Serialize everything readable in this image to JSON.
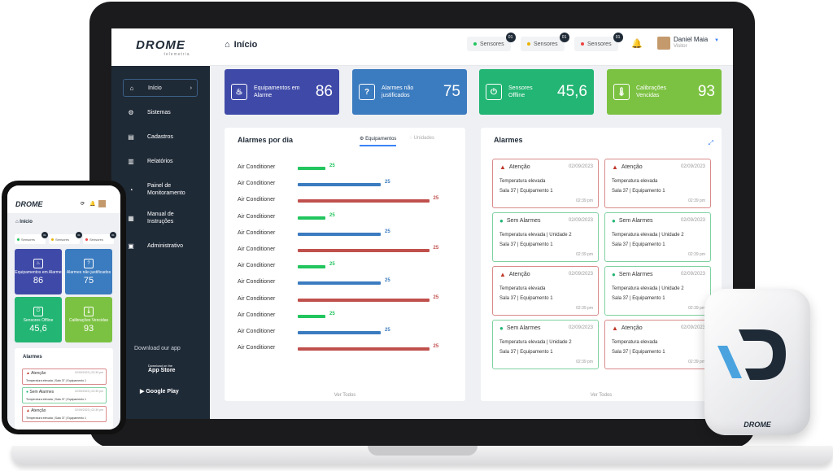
{
  "header": {
    "logo": "DROME",
    "logo_sub": "telemetria",
    "title": "Início",
    "chips": [
      {
        "label": "Sensores",
        "badge": "01",
        "color": "#22c55e"
      },
      {
        "label": "Sensores",
        "badge": "01",
        "color": "#eab308"
      },
      {
        "label": "Sensores",
        "badge": "01",
        "color": "#ef4444"
      }
    ],
    "user_name": "Daniel Maia",
    "user_role": "Visitor"
  },
  "sidebar": {
    "items": [
      {
        "label": "Início",
        "icon": "home-icon"
      },
      {
        "label": "Sistemas",
        "icon": "systems-icon"
      },
      {
        "label": "Cadastros",
        "icon": "register-icon"
      },
      {
        "label": "Relatórios",
        "icon": "reports-icon"
      },
      {
        "label": "Painel de Monitoramento",
        "icon": "pie-icon"
      },
      {
        "label": "Manual de Instruções",
        "icon": "manual-icon"
      },
      {
        "label": "Administrativo",
        "icon": "admin-icon"
      }
    ],
    "download": "Download our app",
    "app_store": "App Store",
    "app_store_small": "Download on the",
    "google_play": "Google Play"
  },
  "stats": [
    {
      "label": "Equipamentos em Alarme",
      "value": "86",
      "color": "#3f4aa8",
      "icon": "alarm-icon"
    },
    {
      "label": "Alarmes não justificados",
      "value": "75",
      "color": "#3b7bbf",
      "icon": "question-icon"
    },
    {
      "label": "Sensores Offline",
      "value": "45,6",
      "color": "#22b573",
      "icon": "power-icon"
    },
    {
      "label": "Calibrações Vencidas",
      "value": "93",
      "color": "#7cc242",
      "icon": "thermometer-icon"
    }
  ],
  "daily": {
    "title": "Alarmes por dia",
    "tab_active": "Equipamentos",
    "tab_inactive": "Unidades",
    "footer": "Ver Todos",
    "rows": [
      {
        "label": "Air Conditioner",
        "value": "25",
        "fraction": 0.2,
        "color": "#22c55e"
      },
      {
        "label": "Air Conditioner",
        "value": "25",
        "fraction": 0.6,
        "color": "#3b7bbf"
      },
      {
        "label": "Air Conditioner",
        "value": "25",
        "fraction": 0.95,
        "color": "#c0504d"
      },
      {
        "label": "Air Conditioner",
        "value": "25",
        "fraction": 0.2,
        "color": "#22c55e"
      },
      {
        "label": "Air Conditioner",
        "value": "25",
        "fraction": 0.6,
        "color": "#3b7bbf"
      },
      {
        "label": "Air Conditioner",
        "value": "25",
        "fraction": 0.95,
        "color": "#c0504d"
      },
      {
        "label": "Air Conditioner",
        "value": "25",
        "fraction": 0.2,
        "color": "#22c55e"
      },
      {
        "label": "Air Conditioner",
        "value": "25",
        "fraction": 0.6,
        "color": "#3b7bbf"
      },
      {
        "label": "Air Conditioner",
        "value": "25",
        "fraction": 0.95,
        "color": "#c0504d"
      },
      {
        "label": "Air Conditioner",
        "value": "25",
        "fraction": 0.2,
        "color": "#22c55e"
      },
      {
        "label": "Air Conditioner",
        "value": "25",
        "fraction": 0.6,
        "color": "#3b7bbf"
      },
      {
        "label": "Air Conditioner",
        "value": "25",
        "fraction": 0.95,
        "color": "#c0504d"
      }
    ]
  },
  "alarms": {
    "title": "Alarmes",
    "footer": "Ver Todos",
    "cards": [
      {
        "status": "Atenção",
        "date": "02/09/2023",
        "line1": "Temperatura elevada",
        "line2": "Sala 37   |   Equipamento 1",
        "time": "02:39 pm",
        "kind": "warn"
      },
      {
        "status": "Atenção",
        "date": "02/09/2023",
        "line1": "Temperatura elevada",
        "line2": "Sala 37   |   Equipamento 1",
        "time": "02:39 pm",
        "kind": "warn"
      },
      {
        "status": "Sem Alarmes",
        "date": "02/09/2023",
        "line1": "Temperatura elevada   |   Unidade 2",
        "line2": "Sala 37   |   Equipamento 1",
        "time": "02:39 pm",
        "kind": "ok"
      },
      {
        "status": "Sem Alarmes",
        "date": "02/09/2023",
        "line1": "Temperatura elevada   |   Unidade 2",
        "line2": "Sala 37   |   Equipamento 1",
        "time": "02:39 pm",
        "kind": "ok"
      },
      {
        "status": "Atenção",
        "date": "02/09/2023",
        "line1": "Temperatura elevada",
        "line2": "Sala 37   |   Equipamento 1",
        "time": "02:39 pm",
        "kind": "warn"
      },
      {
        "status": "Sem Alarmes",
        "date": "02/09/2023",
        "line1": "Temperatura elevada   |   Unidade 2",
        "line2": "Sala 37   |   Equipamento 1",
        "time": "02:39 pm",
        "kind": "ok"
      },
      {
        "status": "Sem Alarmes",
        "date": "02/09/2023",
        "line1": "Temperatura elevada   |   Unidade 2",
        "line2": "Sala 37   |   Equipamento 1",
        "time": "02:39 pm",
        "kind": "ok"
      },
      {
        "status": "Atenção",
        "date": "02/09/2023",
        "line1": "Temperatura elevada",
        "line2": "Sala 37   |   Equipamento 1",
        "time": "02:39 pm",
        "kind": "warn"
      }
    ]
  },
  "phone": {
    "logo": "DROME",
    "title": "Início",
    "chip": "Sensores",
    "chip_badge": "01",
    "alarms_title": "Alarmes",
    "cards": [
      {
        "status": "Atenção",
        "date": "02/09/2023 | 02:39 pm",
        "line": "Temperatura elevada  |  Sala 37  |  Equipamento 1",
        "kind": "warn"
      },
      {
        "status": "Sem Alarmes",
        "date": "02/09/2023 | 02:39 pm",
        "line": "Temperatura elevada  |  Sala 37  |  Equipamento 1",
        "kind": "ok"
      },
      {
        "status": "Atenção",
        "date": "02/09/2023 | 02:39 pm",
        "line": "Temperatura elevada  |  Sala 37  |  Equipamento 1",
        "kind": "warn"
      }
    ]
  },
  "device": {
    "logo": "DROME"
  }
}
